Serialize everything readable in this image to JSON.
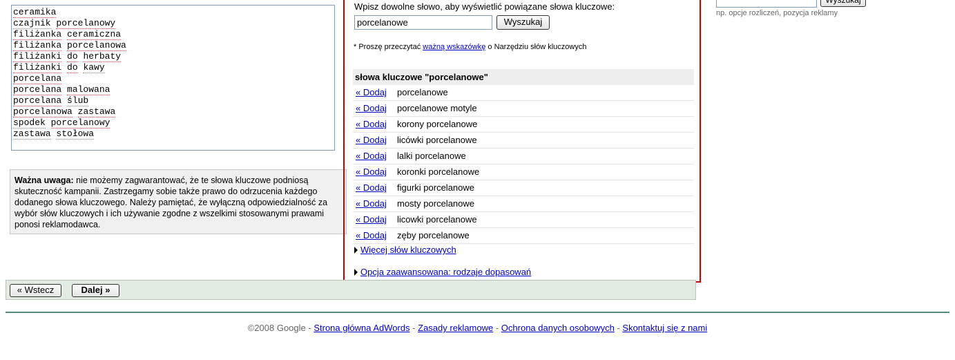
{
  "keywords_list": [
    "ceramika",
    "czajnik porcelanowy",
    "filiżanka ceramiczna",
    "filiżanka porcelanowa",
    "filiżanki do herbaty",
    "filiżanki do kawy",
    "porcelana",
    "porcelana malowana",
    "porcelana ślub",
    "porcelanowa zastawa",
    "spodek porcelanowy",
    "zastawa stołowa"
  ],
  "warning": {
    "bold": "Ważna uwaga:",
    "text": " nie możemy zagwarantować, że te słowa kluczowe podniosą skuteczność kampanii. Zastrzegamy sobie także prawo do odrzucenia każdego dodanego słowa kluczowego. Należy pamiętać, że wyłączną odpowiedzialność za wybór słów kluczowych i ich używanie zgodne z wszelkimi stosowanymi prawami ponosi reklamodawca."
  },
  "tool": {
    "prompt": "Wpisz dowolne słowo, aby wyświetlić powiązane słowa kluczowe:",
    "search_value": "porcelanowe",
    "search_button": "Wyszukaj",
    "note_prefix": "* Proszę przeczytać ",
    "note_link": "ważną wskazówkę",
    "note_suffix": " o Narzędziu słów kluczowych",
    "results_header": "słowa kluczowe \"porcelanowe\"",
    "add_label": "« Dodaj",
    "results": [
      "porcelanowe",
      "porcelanowe motyle",
      "korony porcelanowe",
      "licówki porcelanowe",
      "lalki porcelanowe",
      "koronki porcelanowe",
      "figurki porcelanowe",
      "mosty porcelanowe",
      "licowki porcelanowe",
      "zęby porcelanowe"
    ],
    "more_link": "Więcej słów kluczowych",
    "advanced_link": "Opcja zaawansowana: rodzaje dopasowań"
  },
  "right": {
    "button": "Wyszukaj",
    "hint": "np. opcje rozliczeń, pozycja reklamy"
  },
  "nav": {
    "back": "« Wstecz",
    "next": "Dalej »"
  },
  "footer": {
    "copyright": "©2008 Google - ",
    "links": [
      "Strona główna AdWords",
      "Zasady reklamowe",
      "Ochrona danych osobowych",
      "Skontaktuj się z nami"
    ],
    "separator": " - "
  }
}
